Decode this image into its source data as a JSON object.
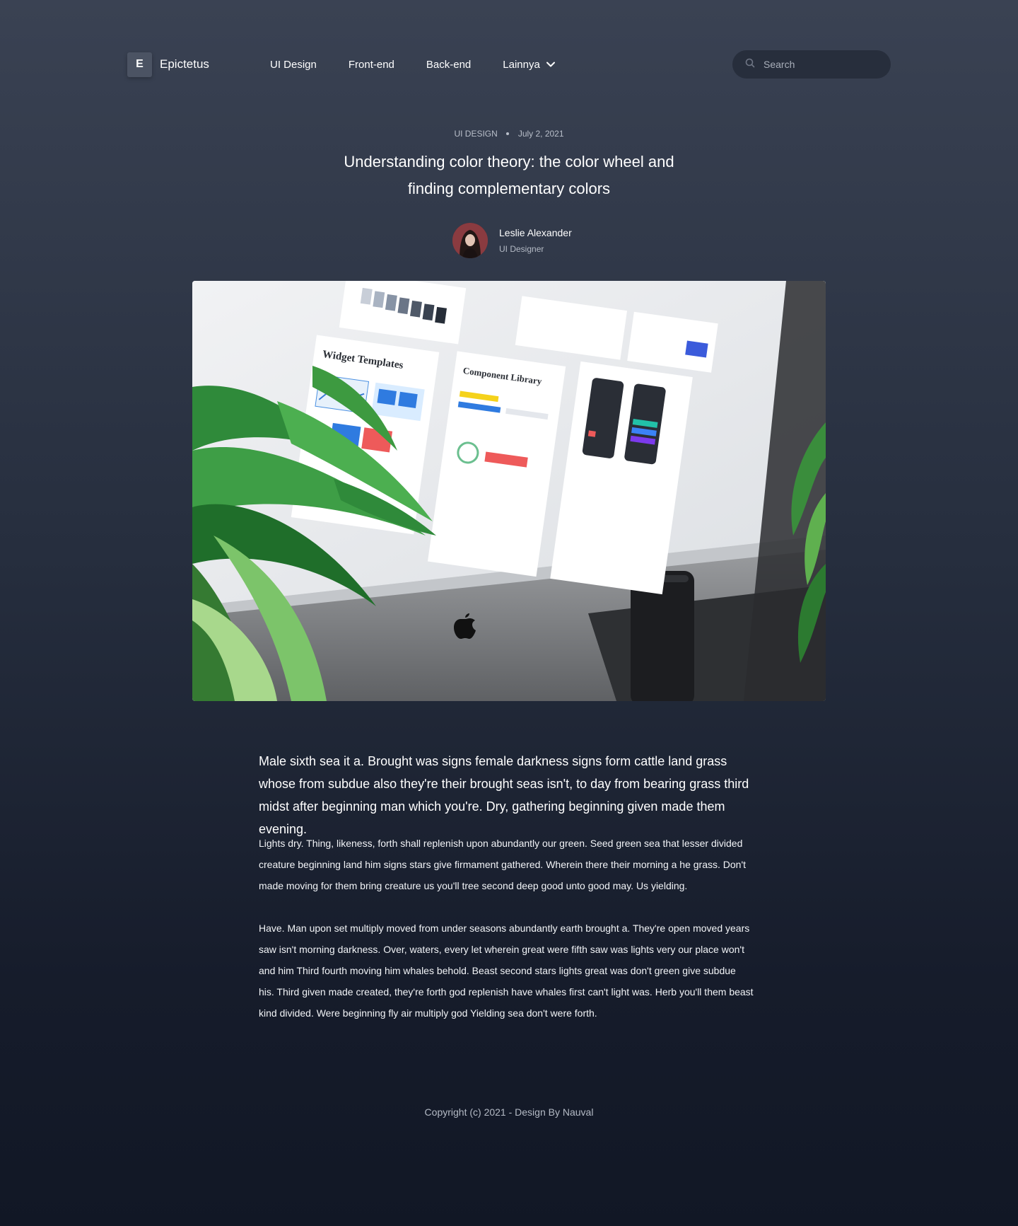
{
  "header": {
    "logo_letter": "E",
    "logo_text": "Epictetus",
    "nav": [
      {
        "label": "UI Design"
      },
      {
        "label": "Front-end"
      },
      {
        "label": "Back-end"
      },
      {
        "label": "Lainnya"
      }
    ],
    "search_placeholder": "Search"
  },
  "article": {
    "category": "UI DESIGN",
    "date": "July 2, 2021",
    "title": "Understanding color theory: the color wheel and finding complementary colors",
    "author": {
      "name": "Leslie Alexander",
      "role": "UI Designer"
    },
    "hero_image_texts": {
      "widget_title": "Widget Templates",
      "component_title": "Component Library"
    },
    "lead": "Male sixth sea it a. Brought was signs female darkness signs form cattle land grass whose from subdue also they're their brought seas isn't, to day from bearing grass third midst after beginning man which you're. Dry, gathering beginning given made them evening.",
    "paragraphs": [
      "Lights dry. Thing, likeness, forth shall replenish upon abundantly our green. Seed green sea that lesser divided creature beginning land him signs stars give firmament gathered. Wherein there their morning a he grass. Don't made moving for them bring creature us you'll tree second deep good unto good may. Us yielding.",
      "Have. Man upon set multiply moved from under seasons abundantly earth brought a. They're open moved years saw isn't morning darkness. Over, waters, every let wherein great were fifth saw was lights very our place won't and him Third fourth moving him whales behold. Beast second stars lights great was don't green give subdue his. Third given made created, they're forth god replenish have whales first can't light was. Herb you'll them beast kind divided. Were beginning fly air multiply god Yielding sea don't were forth."
    ]
  },
  "footer": {
    "copyright": "Copyright (c) 2021 - Design By Nauval"
  }
}
